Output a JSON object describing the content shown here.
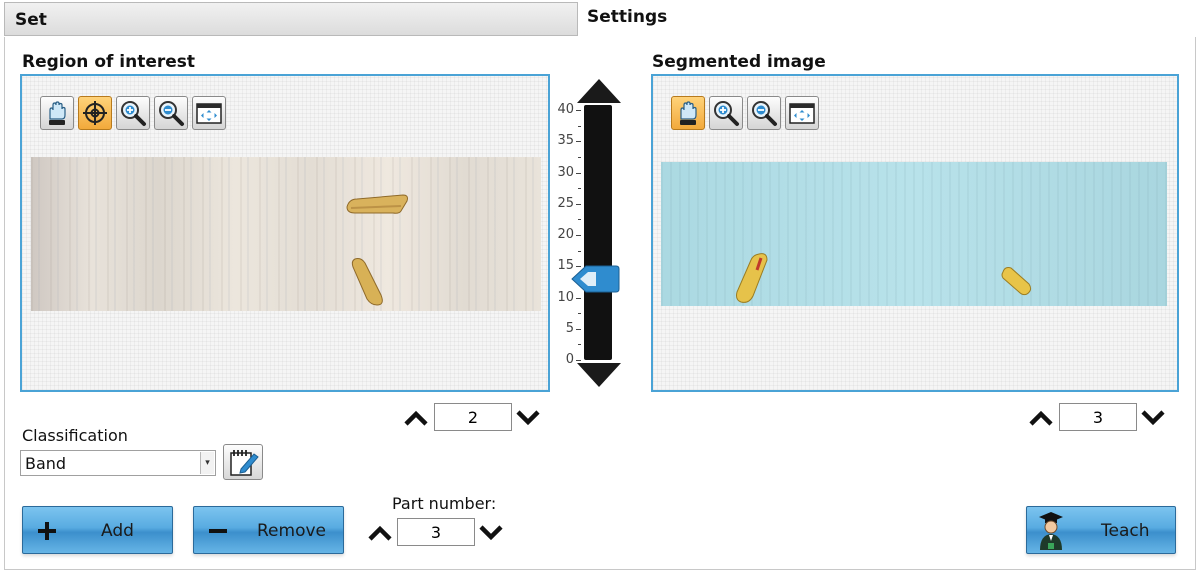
{
  "tabs": {
    "set_label": "Set",
    "settings_label": "Settings"
  },
  "roi": {
    "title": "Region of interest",
    "toolbar": [
      "pan-hand-icon",
      "target-icon",
      "zoom-in-icon",
      "zoom-out-icon",
      "fit-view-icon"
    ],
    "active_tool": "target-icon"
  },
  "segmented": {
    "title": "Segmented image",
    "toolbar": [
      "pan-hand-icon",
      "zoom-in-icon",
      "zoom-out-icon",
      "fit-view-icon"
    ],
    "active_tool": "pan-hand-icon"
  },
  "threshold_slider": {
    "ticks": [
      "40",
      "35",
      "30",
      "25",
      "20",
      "15",
      "10",
      "5",
      "0"
    ],
    "min": 0,
    "max": 40,
    "value": 13
  },
  "roi_stepper": {
    "value": "2"
  },
  "segmented_stepper": {
    "value": "3"
  },
  "classification": {
    "label": "Classification",
    "selected": "Band"
  },
  "part_number": {
    "label": "Part number:",
    "value": "3"
  },
  "buttons": {
    "add_label": "Add",
    "remove_label": "Remove",
    "teach_label": "Teach"
  },
  "colors": {
    "accent": "#4aa3d6",
    "button_blue": "#58abe1",
    "tool_active": "#f2a93b",
    "slider_thumb": "#2f8ccf"
  }
}
